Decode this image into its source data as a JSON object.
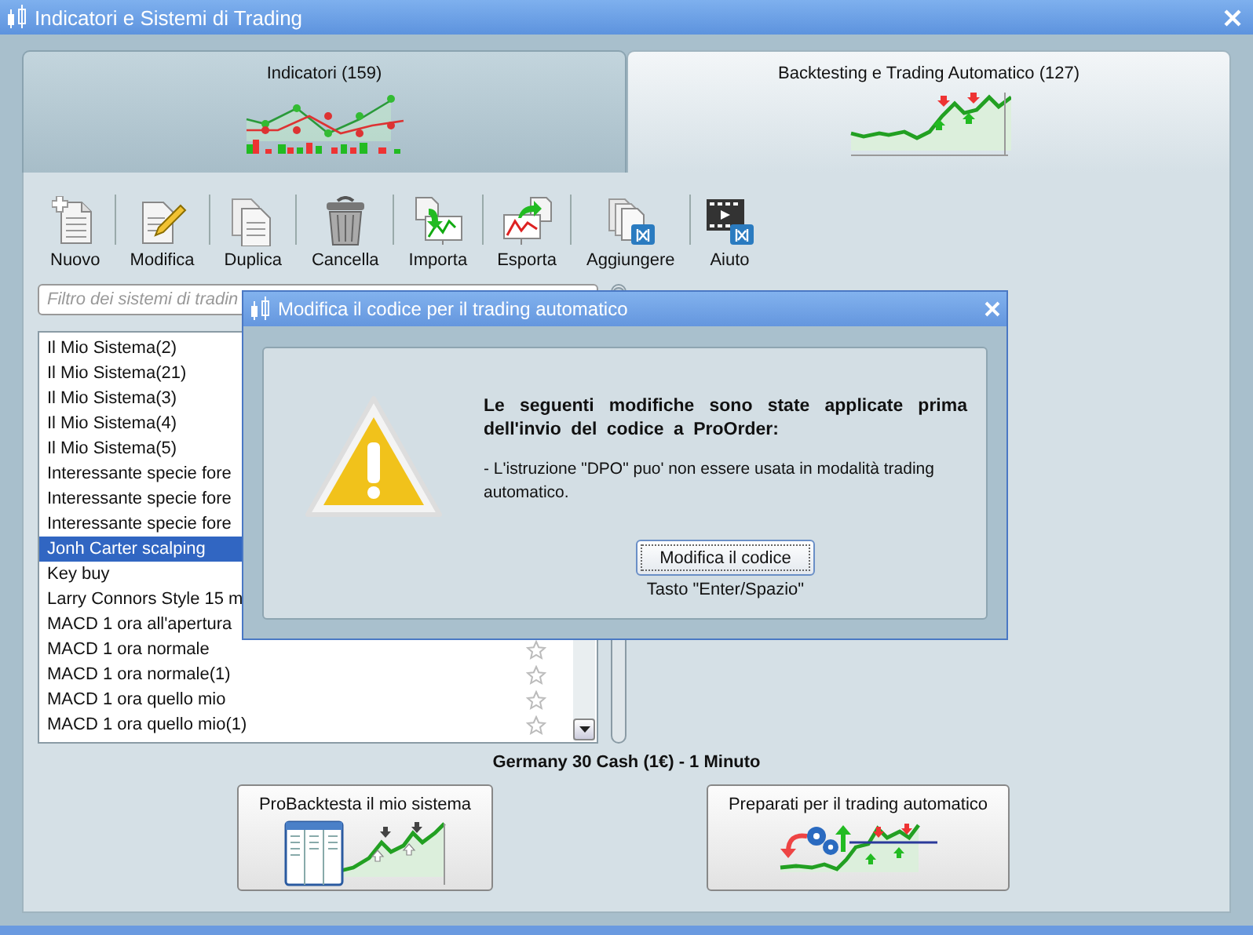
{
  "window": {
    "title": "Indicatori e Sistemi di Trading"
  },
  "tabs": [
    {
      "label": "Indicatori (159)",
      "selected": false,
      "kind": "indicators"
    },
    {
      "label": "Backtesting e Trading Automatico (127)",
      "selected": true,
      "kind": "backtest"
    }
  ],
  "toolbar": [
    {
      "label": "Nuovo",
      "kind": "new"
    },
    {
      "label": "Modifica",
      "kind": "edit"
    },
    {
      "label": "Duplica",
      "kind": "duplicate"
    },
    {
      "label": "Cancella",
      "kind": "delete"
    },
    {
      "label": "Importa",
      "kind": "import"
    },
    {
      "label": "Esporta",
      "kind": "export"
    },
    {
      "label": "Aggiungere",
      "kind": "add"
    },
    {
      "label": "Aiuto",
      "kind": "help"
    }
  ],
  "filter": {
    "placeholder": "Filtro dei sistemi di tradin"
  },
  "systems": [
    {
      "name": "Il Mio Sistema(2)",
      "selected": false
    },
    {
      "name": "Il Mio Sistema(21)",
      "selected": false
    },
    {
      "name": "Il Mio Sistema(3)",
      "selected": false
    },
    {
      "name": "Il Mio Sistema(4)",
      "selected": false
    },
    {
      "name": "Il Mio Sistema(5)",
      "selected": false
    },
    {
      "name": "Interessante specie fore",
      "selected": false
    },
    {
      "name": "Interessante specie fore",
      "selected": false
    },
    {
      "name": "Interessante specie fore",
      "selected": false
    },
    {
      "name": "Jonh Carter scalping",
      "selected": true
    },
    {
      "name": "Key buy",
      "selected": false
    },
    {
      "name": "Larry Connors Style 15 m",
      "selected": false
    },
    {
      "name": "MACD 1 ora all'apertura",
      "selected": false
    },
    {
      "name": "MACD 1 ora normale",
      "selected": false,
      "favorite": false
    },
    {
      "name": "MACD 1 ora normale(1)",
      "selected": false,
      "favorite": false
    },
    {
      "name": "MACD 1 ora quello mio",
      "selected": false,
      "favorite": false
    },
    {
      "name": "MACD 1 ora quello mio(1)",
      "selected": false,
      "favorite": false
    }
  ],
  "instrument": "Germany 30 Cash (1€) - 1 Minuto",
  "actions": [
    {
      "label": "ProBacktesta il mio sistema",
      "kind": "backtest"
    },
    {
      "label": "Preparati per il trading automatico",
      "kind": "auto"
    }
  ],
  "dialog": {
    "title": "Modifica il codice per il trading automatico",
    "heading": "Le seguenti modifiche sono state applicate prima dell'invio del codice a ProOrder:",
    "message": "- L'istruzione \"DPO\" puo' non essere usata in modalità trading automatico.",
    "button": "Modifica il codice",
    "hint": "Tasto \"Enter/Spazio\""
  }
}
